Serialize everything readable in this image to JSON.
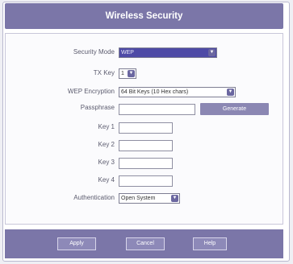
{
  "window": {
    "title": "Wireless Security"
  },
  "form": {
    "security_mode": {
      "label": "Security Mode",
      "value": "WEP"
    },
    "tx_key": {
      "label": "TX Key",
      "value": "1"
    },
    "wep_encryption": {
      "label": "WEP Encryption",
      "value": "64 Bit Keys (10 Hex chars)"
    },
    "passphrase": {
      "label": "Passphrase",
      "value": "",
      "generate_label": "Generate"
    },
    "keys": [
      {
        "label": "Key 1",
        "value": ""
      },
      {
        "label": "Key 2",
        "value": ""
      },
      {
        "label": "Key 3",
        "value": ""
      },
      {
        "label": "Key 4",
        "value": ""
      }
    ],
    "authentication": {
      "label": "Authentication",
      "value": "Open System"
    }
  },
  "footer": {
    "apply_label": "Apply",
    "cancel_label": "Cancel",
    "help_label": "Help"
  },
  "colors": {
    "accent": "#7b76a8",
    "selected_field": "#4e4aa6"
  }
}
